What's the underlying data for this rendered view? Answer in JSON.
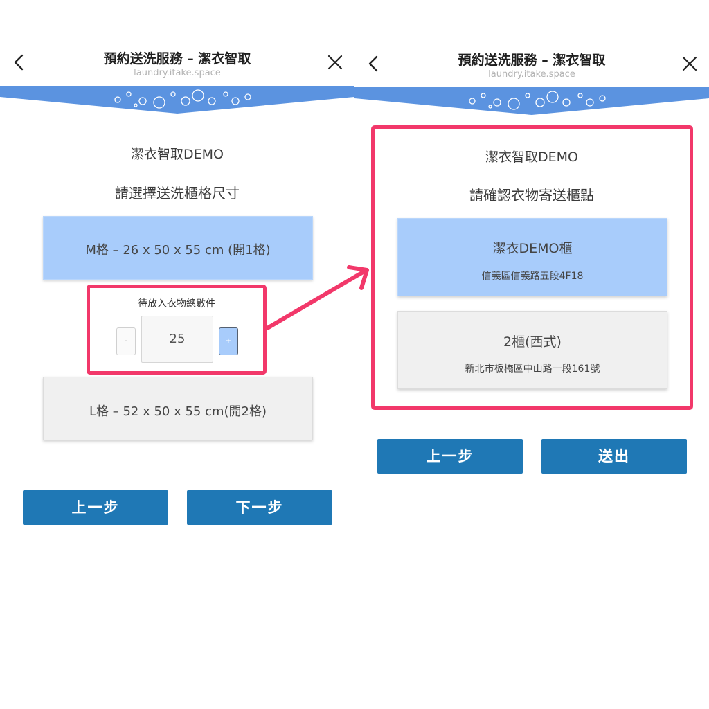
{
  "header": {
    "title": "預約送洗服務 – 潔衣智取",
    "url": "laundry.itake.space"
  },
  "store_name": "潔衣智取DEMO",
  "left": {
    "prompt": "請選擇送洗櫃格尺寸",
    "options": [
      {
        "label": "M格 – 26 x 50 x 55 cm (開1格)",
        "selected": true
      },
      {
        "label": "L格 – 52 x 50 x 55 cm(開2格)",
        "selected": false
      }
    ],
    "quantity": {
      "label": "待放入衣物總數件",
      "value": "25",
      "minus": "-",
      "plus": "+"
    },
    "buttons": {
      "prev": "上一步",
      "next": "下一步"
    }
  },
  "right": {
    "prompt": "請確認衣物寄送櫃點",
    "locations": [
      {
        "name": "潔衣DEMO櫃",
        "address": "信義區信義路五段4F18",
        "selected": true
      },
      {
        "name": "2櫃(西式)",
        "address": "新北市板橋區中山路一段161號",
        "selected": false
      }
    ],
    "buttons": {
      "prev": "上一步",
      "submit": "送出"
    }
  },
  "colors": {
    "accent_blue": "#1f78b5",
    "selected_option": "#a8ccfb",
    "banner_blue": "#5b93e0",
    "highlight_pink": "#f2386a"
  },
  "icons": [
    "back-chevron-icon",
    "close-icon",
    "bubbles-banner",
    "arrow-annotation"
  ]
}
